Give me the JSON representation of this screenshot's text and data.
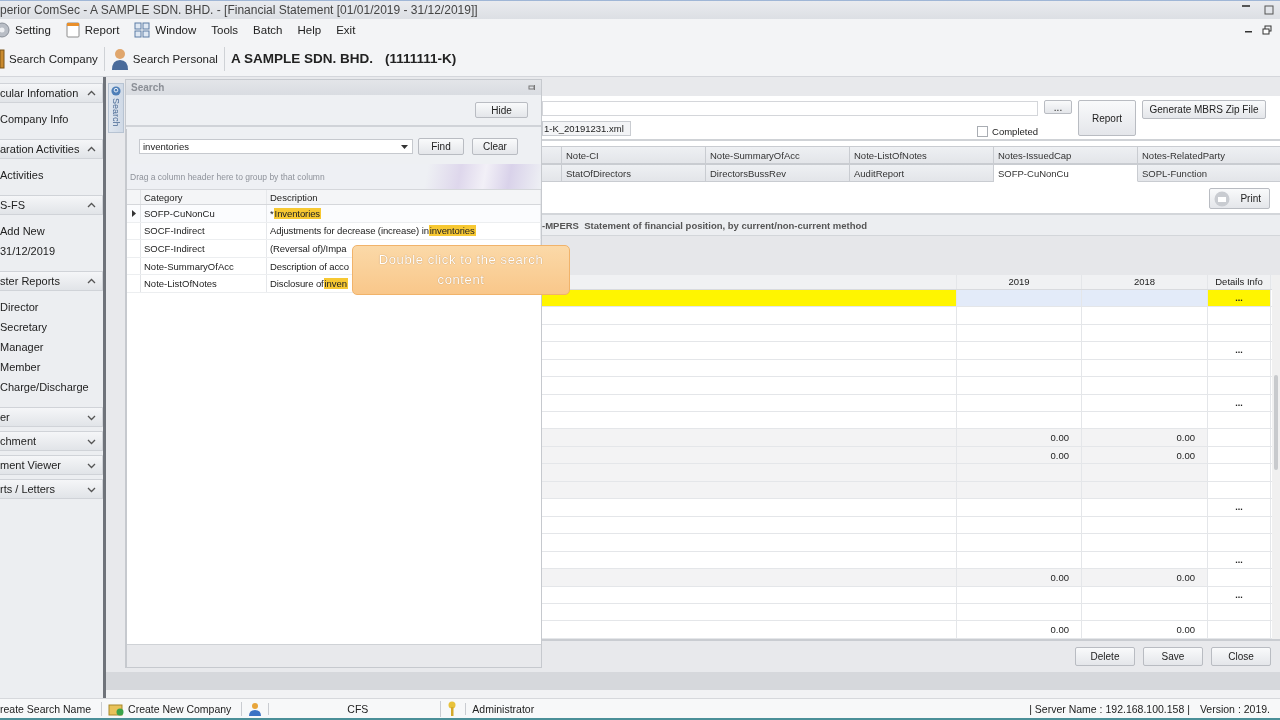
{
  "window": {
    "title": "perior ComSec - A SAMPLE SDN. BHD. - [Financial Statement [01/01/2019 - 31/12/2019]]"
  },
  "menu": [
    {
      "label": "Setting"
    },
    {
      "label": "Report"
    },
    {
      "label": "Window"
    },
    {
      "label": "Tools"
    },
    {
      "label": "Batch"
    },
    {
      "label": "Help"
    },
    {
      "label": "Exit"
    }
  ],
  "toolbar": {
    "buttons": [
      {
        "label": "Search Company"
      },
      {
        "label": "Search Personal"
      }
    ],
    "company": "A SAMPLE SDN. BHD.",
    "company_no": "(1111111-K)"
  },
  "sidebar": {
    "groups": [
      {
        "title": "cular Infomation",
        "expanded": true,
        "items": [
          "Company Info"
        ]
      },
      {
        "title": "aration Activities",
        "expanded": true,
        "items": [
          "Activities"
        ]
      },
      {
        "title": "S-FS",
        "expanded": true,
        "items": [
          "Add New",
          "31/12/2019"
        ]
      },
      {
        "title": "ster Reports",
        "expanded": true,
        "items": [
          "Director",
          "Secretary",
          "Manager",
          "Member",
          "Charge/Discharge"
        ]
      },
      {
        "title": "er",
        "expanded": false
      },
      {
        "title": "chment",
        "expanded": false
      },
      {
        "title": "ment Viewer",
        "expanded": false
      },
      {
        "title": "rts / Letters",
        "expanded": false
      }
    ]
  },
  "search_panel": {
    "tab_label": "Search",
    "title": "Search",
    "hide_button": "Hide",
    "query": "inventories",
    "find_button": "Find",
    "clear_button": "Clear",
    "group_hint": "Drag a column header here to group by that column",
    "columns": [
      "Category",
      "Description"
    ],
    "rows": [
      {
        "category": "SOFP-CuNonCu",
        "selected": true,
        "description": [
          {
            "text": "*"
          },
          {
            "text": "Inventories",
            "match": true
          }
        ]
      },
      {
        "category": "SOCF-Indirect",
        "selected": false,
        "description": [
          {
            "text": "Adjustments for decrease (increase) in "
          },
          {
            "text": "inventories",
            "match": true
          }
        ]
      },
      {
        "category": "SOCF-Indirect",
        "selected": false,
        "description": [
          {
            "text": "(Reversal of)/Impa"
          }
        ]
      },
      {
        "category": "Note-SummaryOfAcc",
        "selected": false,
        "description": [
          {
            "text": "Description of acco"
          }
        ]
      },
      {
        "category": "Note-ListOfNotes",
        "selected": false,
        "description": [
          {
            "text": "Disclosure of "
          },
          {
            "text": "inven",
            "match": true
          }
        ]
      }
    ]
  },
  "tooltip": {
    "text": "Double click to the search content"
  },
  "statement": {
    "file_name": "1-K_20191231.xml",
    "browse_button": "...",
    "report_button": "Report",
    "generate_button": "Generate MBRS Zip File",
    "completed": {
      "label": "Completed",
      "checked": false
    },
    "tabs": [
      [
        {
          "label": "Note-CI",
          "selected": false
        },
        {
          "label": "Note-SummaryOfAcc",
          "selected": false
        },
        {
          "label": "Note-ListOfNotes",
          "selected": false
        },
        {
          "label": "Notes-IssuedCap",
          "selected": false
        },
        {
          "label": "Notes-RelatedParty",
          "selected": false
        }
      ],
      [
        {
          "label": "StatOfDirectors",
          "selected": false
        },
        {
          "label": "DirectorsBussRev",
          "selected": false
        },
        {
          "label": "AuditReport",
          "selected": false
        },
        {
          "label": "SOFP-CuNonCu",
          "selected": true
        },
        {
          "label": "SOPL-Function",
          "selected": false
        }
      ]
    ],
    "print_button": "Print",
    "section_title": "-MPERS  Statement of financial position, by current/non-current method",
    "table": {
      "year_columns": [
        "2019",
        "2018"
      ],
      "details_column": "Details Info",
      "rows": [
        {
          "kind": "highlight",
          "details": "..."
        },
        {
          "kind": "plain"
        },
        {
          "kind": "plain"
        },
        {
          "kind": "plain",
          "details": "..."
        },
        {
          "kind": "plain"
        },
        {
          "kind": "plain"
        },
        {
          "kind": "plain",
          "details": "..."
        },
        {
          "kind": "plain"
        },
        {
          "kind": "shaded",
          "current": "0.00",
          "prior": "0.00"
        },
        {
          "kind": "shaded",
          "current": "0.00",
          "prior": "0.00"
        },
        {
          "kind": "shaded"
        },
        {
          "kind": "shaded"
        },
        {
          "kind": "plain",
          "details": "..."
        },
        {
          "kind": "plain"
        },
        {
          "kind": "plain"
        },
        {
          "kind": "plain",
          "details": "..."
        },
        {
          "kind": "shaded",
          "current": "0.00",
          "prior": "0.00"
        },
        {
          "kind": "plain",
          "details": "..."
        },
        {
          "kind": "plain"
        },
        {
          "kind": "plain",
          "current": "0.00",
          "prior": "0.00"
        }
      ]
    },
    "actions": [
      "Delete",
      "Save",
      "Close"
    ]
  },
  "status_bar": {
    "search_name": "reate Search Name",
    "new_company": "Create New Company",
    "app": "CFS",
    "user": "Administrator",
    "server": "| Server Name : 192.168.100.158 |",
    "version": "Version : 2019."
  }
}
